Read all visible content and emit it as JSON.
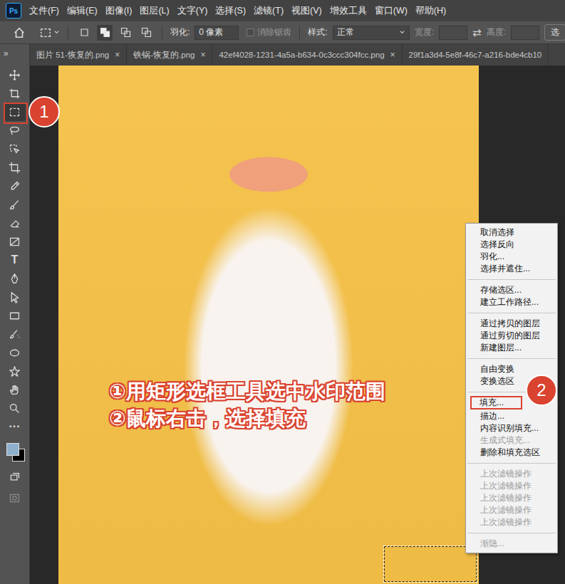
{
  "app": {
    "logo": "Ps"
  },
  "menu": [
    "文件(F)",
    "编辑(E)",
    "图像(I)",
    "图层(L)",
    "文字(Y)",
    "选择(S)",
    "滤镜(T)",
    "视图(V)",
    "增效工具",
    "窗口(W)",
    "帮助(H)"
  ],
  "options": {
    "modes": [
      {
        "mode": "new",
        "selected": false
      },
      {
        "mode": "add",
        "selected": true
      },
      {
        "mode": "subtract",
        "selected": false
      },
      {
        "mode": "intersect",
        "selected": false
      }
    ],
    "feather_label": "羽化:",
    "feather_value": "0 像素",
    "antialias": {
      "label": "消除锯齿",
      "checked": false,
      "disabled": true
    },
    "style_label": "样式:",
    "style_value": "正常",
    "width": {
      "label": "宽度:",
      "disabled": true
    },
    "swap": "⇄",
    "height": {
      "label": "高度:",
      "disabled": true
    },
    "cut_button": "选"
  },
  "panel_toggle": "»",
  "tabs": [
    {
      "label": "图片 51-恢复的.png",
      "close": "×",
      "selected": false
    },
    {
      "label": "铁锅-恢复的.png",
      "close": "×",
      "selected": false
    },
    {
      "label": "42ef4028-1231-4a5a-b634-0c3ccc304fcc.png",
      "close": "×",
      "selected": false
    },
    {
      "label": "29f1a3d4-5e8f-46c7-a216-bde4cb10",
      "close": "",
      "selected": false
    }
  ],
  "tools": [
    {
      "kind": "icon",
      "icon": "move",
      "glyph": "",
      "selected": false
    },
    {
      "kind": "icon",
      "icon": "artboard",
      "glyph": "",
      "selected": false
    },
    {
      "kind": "icon",
      "icon": "marquee",
      "glyph": "",
      "selected": true
    },
    {
      "kind": "icon",
      "icon": "lasso",
      "glyph": "",
      "selected": false
    },
    {
      "kind": "icon",
      "icon": "object-select",
      "glyph": "",
      "selected": false
    },
    {
      "kind": "icon",
      "icon": "crop",
      "glyph": "",
      "selected": false
    },
    {
      "kind": "icon",
      "icon": "eyedropper",
      "glyph": "",
      "selected": false
    },
    {
      "kind": "icon",
      "icon": "brush",
      "glyph": "",
      "selected": false
    },
    {
      "kind": "icon",
      "icon": "eraser",
      "glyph": "",
      "selected": false
    },
    {
      "kind": "icon",
      "icon": "gradient",
      "glyph": "",
      "selected": false
    },
    {
      "kind": "glyph",
      "icon": "type",
      "glyph": "T",
      "selected": false
    },
    {
      "kind": "icon",
      "icon": "pen",
      "glyph": "",
      "selected": false
    },
    {
      "kind": "icon",
      "icon": "path-select",
      "glyph": "",
      "selected": false
    },
    {
      "kind": "icon",
      "icon": "rectangle",
      "glyph": "",
      "selected": false
    },
    {
      "kind": "icon",
      "icon": "heal",
      "glyph": "",
      "selected": false
    },
    {
      "kind": "icon",
      "icon": "ellipse",
      "glyph": "",
      "selected": false
    },
    {
      "kind": "icon",
      "icon": "puppet",
      "glyph": "",
      "selected": false
    },
    {
      "kind": "icon",
      "icon": "hand",
      "glyph": "",
      "selected": false
    },
    {
      "kind": "icon",
      "icon": "zoom",
      "glyph": "",
      "selected": false
    },
    {
      "kind": "glyph",
      "icon": "more",
      "glyph": "···",
      "selected": false
    }
  ],
  "colors": {
    "foreground": "#8fb0cc",
    "background": "#000000"
  },
  "context_menu": [
    [
      {
        "label": "取消选择",
        "disabled": false,
        "marked": false
      },
      {
        "label": "选择反向",
        "disabled": false,
        "marked": false
      },
      {
        "label": "羽化...",
        "disabled": false,
        "marked": false
      },
      {
        "label": "选择并遮住...",
        "disabled": false,
        "marked": false
      }
    ],
    [
      {
        "label": "存储选区...",
        "disabled": false,
        "marked": false
      },
      {
        "label": "建立工作路径...",
        "disabled": false,
        "marked": false
      }
    ],
    [
      {
        "label": "通过拷贝的图层",
        "disabled": false,
        "marked": false
      },
      {
        "label": "通过剪切的图层",
        "disabled": false,
        "marked": false
      },
      {
        "label": "新建图层...",
        "disabled": false,
        "marked": false
      }
    ],
    [
      {
        "label": "自由变换",
        "disabled": false,
        "marked": false
      },
      {
        "label": "变换选区",
        "disabled": false,
        "marked": false
      }
    ],
    [
      {
        "label": "填充...",
        "disabled": false,
        "marked": true
      },
      {
        "label": "描边...",
        "disabled": false,
        "marked": false
      },
      {
        "label": "内容识别填充...",
        "disabled": false,
        "marked": false
      },
      {
        "label": "生成式填充...",
        "disabled": true,
        "marked": false
      },
      {
        "label": "删除和填充选区",
        "disabled": false,
        "marked": false
      }
    ],
    [
      {
        "label": "上次滤镜操作",
        "disabled": true,
        "marked": false
      },
      {
        "label": "上次滤镜操作",
        "disabled": true,
        "marked": false
      },
      {
        "label": "上次滤镜操作",
        "disabled": true,
        "marked": false
      },
      {
        "label": "上次滤镜操作",
        "disabled": true,
        "marked": false
      },
      {
        "label": "上次滤镜操作",
        "disabled": true,
        "marked": false
      }
    ],
    [
      {
        "label": "渐隐...",
        "disabled": true,
        "marked": false
      }
    ]
  ],
  "annotation": {
    "badges": [
      "1",
      "2"
    ],
    "lines": [
      "①用矩形选框工具选中水印范围",
      "②鼠标右击，选择填充"
    ]
  },
  "selection": {
    "visible": true
  }
}
